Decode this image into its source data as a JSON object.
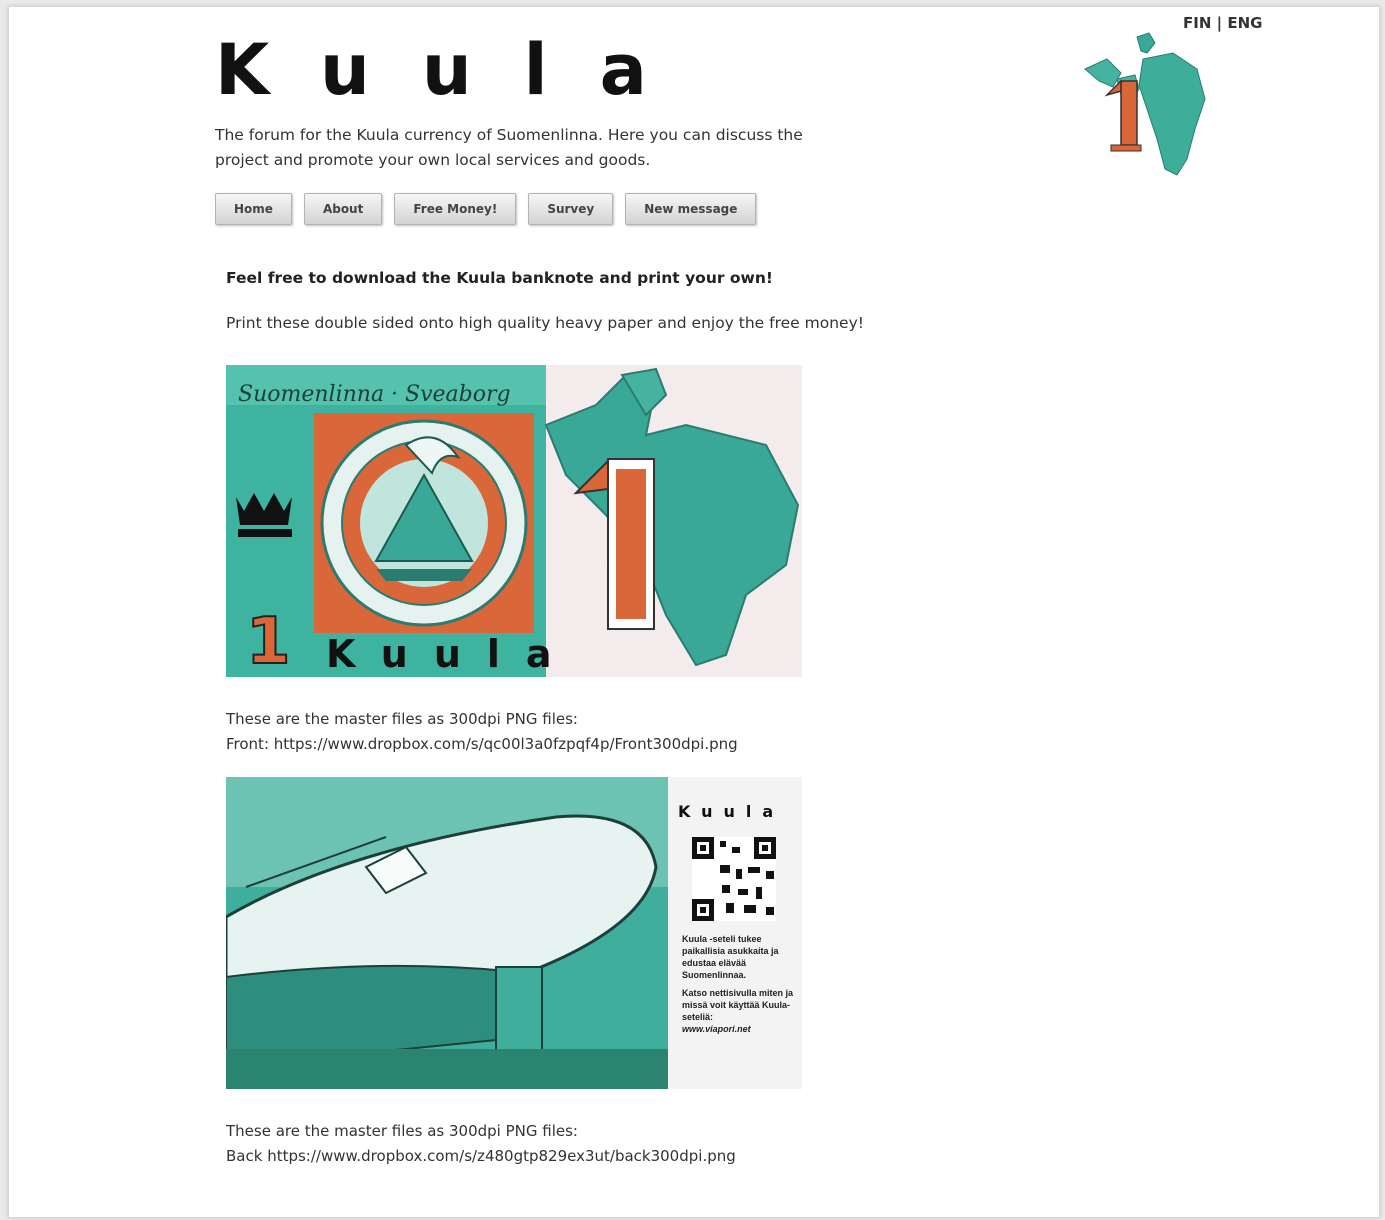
{
  "header": {
    "logo_text": "Kuula",
    "tagline": "The forum for the Kuula currency of Suomenlinna. Here you can discuss the project and promote your own local services and goods.",
    "lang_fin": "FIN",
    "lang_sep": "|",
    "lang_eng": "ENG"
  },
  "nav": {
    "home": "Home",
    "about": "About",
    "free_money": "Free Money!",
    "survey": "Survey",
    "new_message": "New message"
  },
  "main": {
    "heading": "Feel free to download the Kuula banknote and print your own!",
    "instructions": "Print these double sided onto high quality heavy paper and enjoy the free money!",
    "front_note_line1": "These are the master files as 300dpi PNG files:",
    "front_note_label": "Front:",
    "front_link": "https://www.dropbox.com/s/qc00l3a0fzpqf4p/Front300dpi.png",
    "back_note_line1": "These are the master files as 300dpi PNG files:",
    "back_note_label": "Back",
    "back_link": "https://www.dropbox.com/s/z480gtp829ex3ut/back300dpi.png"
  },
  "banknote_front": {
    "script_title": "Suomenlinna · Sveaborg",
    "denomination": "1",
    "big_numeral": "1",
    "word": "Kuula"
  },
  "banknote_back": {
    "word": "Kuula",
    "text1": "Kuula -seteli tukee paikallisia asukkaita ja edustaa elävää Suomenlinnaa.",
    "text2": "Katso nettisivulla miten ja missä voit käyttää Kuula-seteliä:",
    "url": "www.viapori.net"
  },
  "colors": {
    "teal": "#2fa58f",
    "orange": "#d9673a",
    "button_top": "#f6f6f6",
    "button_bottom": "#d3d3d3"
  }
}
